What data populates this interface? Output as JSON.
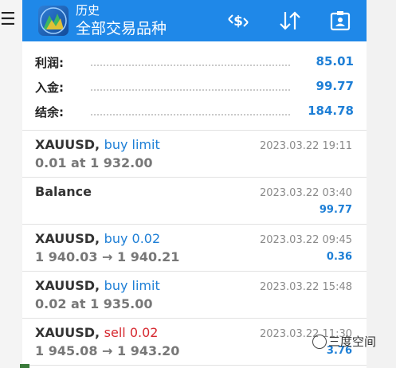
{
  "header": {
    "subtitle": "历史",
    "title": "全部交易品种",
    "icons": [
      "exchange-dollar-icon",
      "sort-icon",
      "id-card-icon"
    ]
  },
  "summary": [
    {
      "label": "利润:",
      "value": "85.01"
    },
    {
      "label": "入金:",
      "value": "99.77"
    },
    {
      "label": "结余:",
      "value": "184.78"
    }
  ],
  "deals": [
    {
      "symbol": "XAUUSD",
      "sep": ", ",
      "type": "buy limit",
      "type_color": "blue",
      "detail": "0.01 at 1 932.00",
      "time": "2023.03.22 19:11",
      "profit": ""
    },
    {
      "symbol": "Balance",
      "sep": "",
      "type": "",
      "type_color": "blue",
      "detail": "",
      "time": "2023.03.22 03:40",
      "profit": "99.77"
    },
    {
      "symbol": "XAUUSD",
      "sep": ", ",
      "type": "buy 0.02",
      "type_color": "blue",
      "detail": "1 940.03 → 1 940.21",
      "time": "2023.03.22 09:45",
      "profit": "0.36"
    },
    {
      "symbol": "XAUUSD",
      "sep": ", ",
      "type": "buy limit",
      "type_color": "blue",
      "detail": "0.02 at 1 935.00",
      "time": "2023.03.22 15:48",
      "profit": ""
    },
    {
      "symbol": "XAUUSD",
      "sep": ", ",
      "type": "sell 0.02",
      "type_color": "red",
      "detail": "1 945.08 → 1 943.20",
      "time": "2023.03.22 11:30",
      "profit": "3.76"
    }
  ],
  "watermark": "三度空间",
  "colors": {
    "accent": "#1f88e8",
    "profit_blue": "#1e7fd6",
    "sell_red": "#d6282f"
  }
}
